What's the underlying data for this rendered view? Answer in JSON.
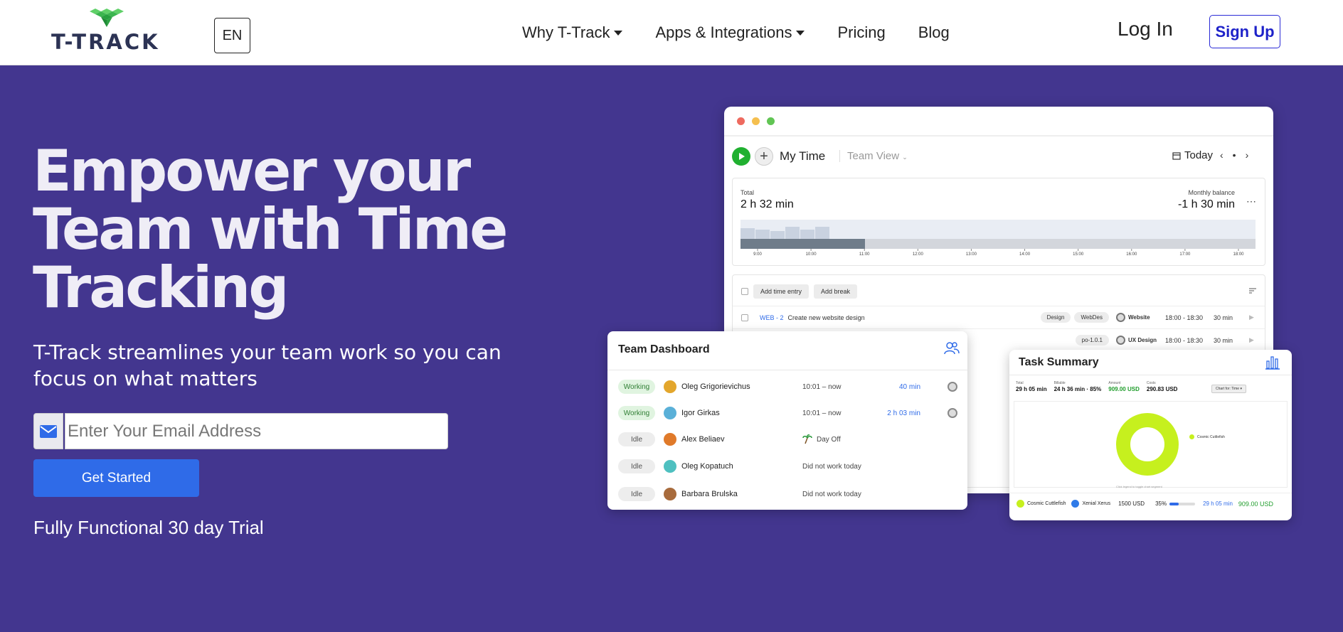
{
  "header": {
    "logo_text": "T-TRACK",
    "lang": "EN",
    "nav": [
      {
        "label": "Why T-Track",
        "dropdown": true
      },
      {
        "label": "Apps & Integrations",
        "dropdown": true
      },
      {
        "label": "Pricing",
        "dropdown": false
      },
      {
        "label": "Blog",
        "dropdown": false
      }
    ],
    "login": "Log In",
    "signup": "Sign Up"
  },
  "hero": {
    "title_lines": [
      "Empower your",
      "Team with Time",
      "Tracking"
    ],
    "subtitle_lines": [
      "T-Track streamlines your team work so you can",
      "focus on what matters"
    ],
    "email_placeholder": "Enter Your Email Address",
    "cta": "Get Started",
    "trial": "Fully Functional 30 day Trial"
  },
  "app": {
    "title": "My Time",
    "view": "Team View",
    "date": "Today",
    "total_label": "Total",
    "total_value": "2 h 32 min",
    "balance_label": "Monthly balance",
    "balance_value": "-1 h 30 min",
    "hours": [
      "9:00",
      "10:00",
      "11:00",
      "12:00",
      "13:00",
      "14:00",
      "15:00",
      "16:00",
      "17:00",
      "18:00"
    ],
    "add_entry": "Add time entry",
    "add_break": "Add break",
    "entries": [
      {
        "ticket": "WEB - 2",
        "desc": "Create new website design",
        "tags": [
          "Design",
          "WebDes"
        ],
        "project": "Website",
        "range": "18:00 - 18:30",
        "dur": "30 min"
      },
      {
        "ticket": "",
        "desc": "",
        "tags": [
          "po-1.0.1"
        ],
        "project": "UX Design",
        "range": "18:00 - 18:30",
        "dur": "30 min"
      }
    ],
    "colors": {
      "red": "#ee6a5f",
      "yellow": "#f5bf4f",
      "green": "#61c554"
    }
  },
  "team": {
    "title": "Team Dashboard",
    "members": [
      {
        "status": "Working",
        "name": "Oleg Grigorievichus",
        "time": "10:01  –   now",
        "dur": "40 min",
        "extra": "",
        "avatar": "#e3a62c"
      },
      {
        "status": "Working",
        "name": "Igor Girkas",
        "time": "10:01  –   now",
        "dur": "2 h 03 min",
        "extra": "",
        "avatar": "#5ab0d8"
      },
      {
        "status": "Idle",
        "name": "Alex Beliaev",
        "time": "",
        "dur": "",
        "extra": "Day Off",
        "avatar": "#e07a2a"
      },
      {
        "status": "Idle",
        "name": "Oleg Kopatuch",
        "time": "Did not work today",
        "dur": "",
        "extra": "",
        "avatar": "#4ec0c0"
      },
      {
        "status": "Idle",
        "name": "Barbara Brulska",
        "time": "Did not work today",
        "dur": "",
        "extra": "",
        "avatar": "#a86b3c"
      }
    ]
  },
  "task": {
    "title": "Task Summary",
    "stats": [
      {
        "label": "Total",
        "value": "29 h 05 min",
        "green": false
      },
      {
        "label": "Billable",
        "value": "24 h 36 min · 85%",
        "green": false
      },
      {
        "label": "Amount",
        "value": "909.00 USD",
        "green": true
      },
      {
        "label": "Costs",
        "value": "290.83 USD",
        "green": false
      }
    ],
    "chart_select": "Chart for: Time",
    "legend": "Cosmic Cuttlefish",
    "hint": "Click legend to toggle chart segment",
    "row": {
      "name1": "Cosmic Cuttlefish",
      "name2": "Xenial Xerus",
      "budget": "1500 USD",
      "pct": "35%",
      "progress": 0.35,
      "dur": "29 h 05 min",
      "amount": "909.00 USD"
    },
    "colors": {
      "donut": "#c6f01e",
      "xerus": "#2f7be8"
    }
  }
}
